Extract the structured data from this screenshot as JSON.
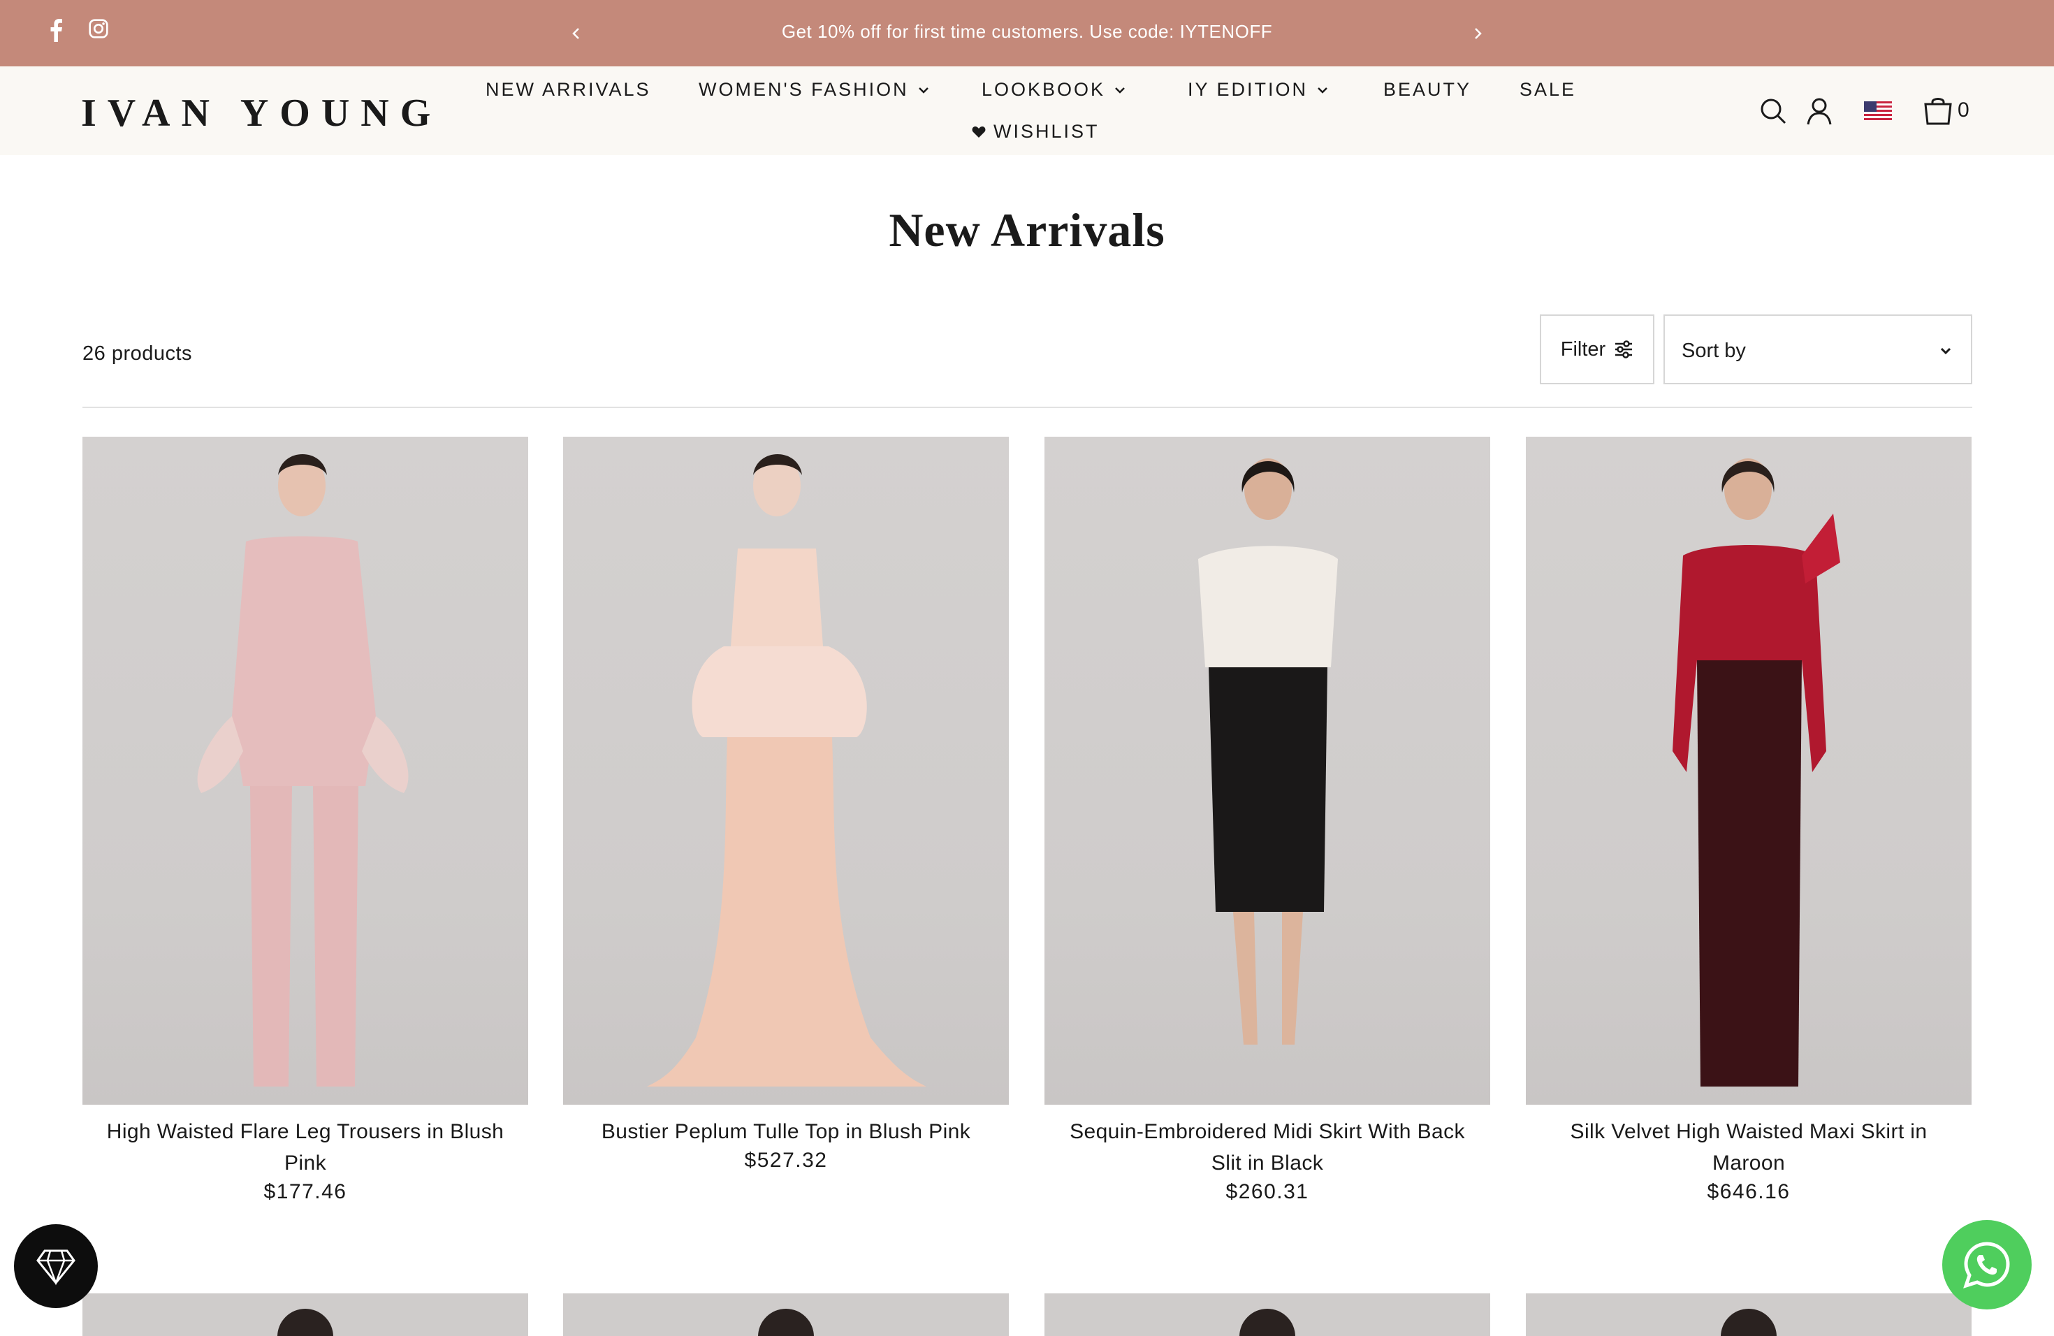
{
  "announcement": {
    "message": "Get 10% off for first time customers. Use code: IYTENOFF",
    "icons": [
      "facebook-icon",
      "instagram-icon"
    ]
  },
  "header": {
    "logo": "IVAN YOUNG",
    "nav": [
      {
        "label": "NEW ARRIVALS",
        "has_dropdown": false
      },
      {
        "label": "WOMEN'S FASHION",
        "has_dropdown": true
      },
      {
        "label": "LOOKBOOK",
        "has_dropdown": true
      },
      {
        "label": "IY EDITION",
        "has_dropdown": true
      },
      {
        "label": "BEAUTY",
        "has_dropdown": false
      },
      {
        "label": "SALE",
        "has_dropdown": false
      },
      {
        "label": "WISHLIST",
        "has_dropdown": false
      }
    ],
    "cart_count": "0",
    "icons": [
      "search-icon",
      "account-icon",
      "us-flag-icon",
      "cart-icon"
    ]
  },
  "page": {
    "title": "New Arrivals",
    "product_count": "26 products",
    "filter_label": "Filter",
    "sort_label": "Sort by"
  },
  "products": [
    {
      "title": "High Waisted Flare Leg Trousers in Blush Pink",
      "price": "$177.46"
    },
    {
      "title": "Bustier Peplum Tulle Top in Blush Pink",
      "price": "$527.32"
    },
    {
      "title": "Sequin-Embroidered Midi Skirt With Back Slit in Black",
      "price": "$260.31"
    },
    {
      "title": "Silk Velvet High Waisted Maxi Skirt in Maroon",
      "price": "$646.16"
    }
  ],
  "colors": {
    "announcement_bg": "#c4897a",
    "header_bg": "#faf8f4",
    "whatsapp": "#4fce5d"
  }
}
